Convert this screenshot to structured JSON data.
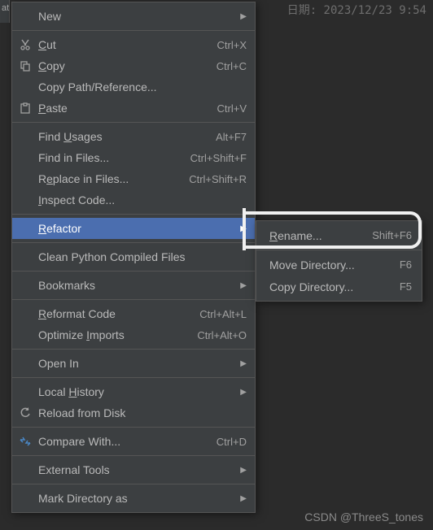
{
  "header": {
    "date_label": "日期:   2023/12/23  9:54"
  },
  "tab_edge": "at",
  "menu": {
    "items": [
      {
        "id": "new",
        "label": "New",
        "shortcut": "",
        "arrow": true,
        "icon": ""
      },
      "sep",
      {
        "id": "cut",
        "label": "Cut",
        "u": 0,
        "shortcut": "Ctrl+X",
        "icon": "cut"
      },
      {
        "id": "copy",
        "label": "Copy",
        "u": 0,
        "shortcut": "Ctrl+C",
        "icon": "copy"
      },
      {
        "id": "copy-path",
        "label": "Copy Path/Reference...",
        "shortcut": "",
        "icon": ""
      },
      {
        "id": "paste",
        "label": "Paste",
        "u": 0,
        "shortcut": "Ctrl+V",
        "icon": "paste"
      },
      "sep",
      {
        "id": "find-usages",
        "label": "Find Usages",
        "u": 5,
        "shortcut": "Alt+F7",
        "icon": ""
      },
      {
        "id": "find-in-files",
        "label": "Find in Files...",
        "shortcut": "Ctrl+Shift+F",
        "icon": ""
      },
      {
        "id": "replace-in-files",
        "label": "Replace in Files...",
        "u": 1,
        "shortcut": "Ctrl+Shift+R",
        "icon": ""
      },
      {
        "id": "inspect-code",
        "label": "Inspect Code...",
        "u": 0,
        "shortcut": "",
        "icon": ""
      },
      "sep",
      {
        "id": "refactor",
        "label": "Refactor",
        "u": 0,
        "shortcut": "",
        "arrow": true,
        "icon": "",
        "selected": true
      },
      "sep",
      {
        "id": "clean-pyc",
        "label": "Clean Python Compiled Files",
        "shortcut": "",
        "icon": ""
      },
      "sep",
      {
        "id": "bookmarks",
        "label": "Bookmarks",
        "shortcut": "",
        "arrow": true,
        "icon": ""
      },
      "sep",
      {
        "id": "reformat",
        "label": "Reformat Code",
        "u": 0,
        "shortcut": "Ctrl+Alt+L",
        "icon": ""
      },
      {
        "id": "optimize-imports",
        "label": "Optimize Imports",
        "u": 9,
        "shortcut": "Ctrl+Alt+O",
        "icon": ""
      },
      "sep",
      {
        "id": "open-in",
        "label": "Open In",
        "shortcut": "",
        "arrow": true,
        "icon": ""
      },
      "sep",
      {
        "id": "local-history",
        "label": "Local History",
        "u": 6,
        "shortcut": "",
        "arrow": true,
        "icon": ""
      },
      {
        "id": "reload-disk",
        "label": "Reload from Disk",
        "shortcut": "",
        "icon": "reload"
      },
      "sep",
      {
        "id": "compare-with",
        "label": "Compare With...",
        "shortcut": "Ctrl+D",
        "icon": "compare"
      },
      "sep",
      {
        "id": "external-tools",
        "label": "External Tools",
        "shortcut": "",
        "arrow": true,
        "icon": ""
      },
      "sep",
      {
        "id": "mark-dir",
        "label": "Mark Directory as",
        "shortcut": "",
        "arrow": true,
        "icon": ""
      }
    ]
  },
  "submenu": {
    "items": [
      {
        "id": "rename",
        "label": "Rename...",
        "u": 0,
        "shortcut": "Shift+F6"
      },
      {
        "id": "sep",
        "sep": true
      },
      {
        "id": "move-dir",
        "label": "Move Directory...",
        "shortcut": "F6"
      },
      {
        "id": "copy-dir",
        "label": "Copy Directory...",
        "shortcut": "F5"
      }
    ]
  },
  "watermark": "CSDN @ThreeS_tones"
}
